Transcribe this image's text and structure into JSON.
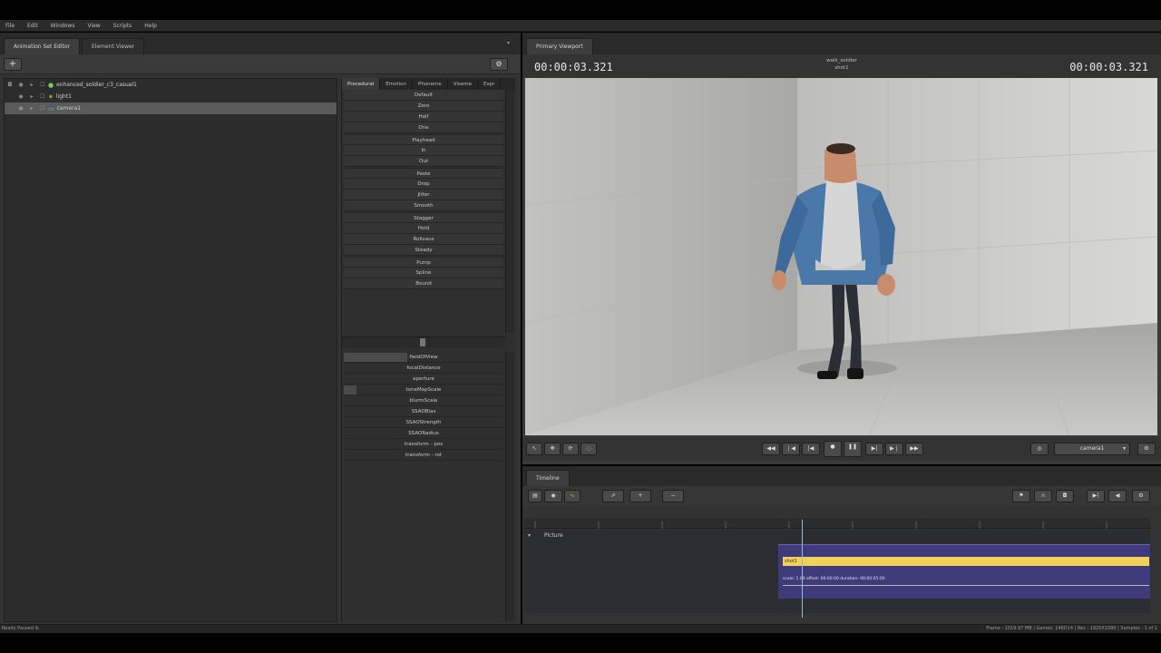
{
  "menu": [
    "File",
    "Edit",
    "Windows",
    "View",
    "Scripts",
    "Help"
  ],
  "left_tabs": [
    "Animation Set Editor",
    "Element Viewer"
  ],
  "tree_items": [
    {
      "label": "enhanced_soldier_c3_casual1",
      "selected": false
    },
    {
      "label": "light1",
      "selected": false
    },
    {
      "label": "camera1",
      "selected": true
    }
  ],
  "presets_tabs": [
    "Procedural",
    "Emotion",
    "Phoneme",
    "Viseme",
    "Expr"
  ],
  "preset_buttons": [
    {
      "label": "Default",
      "group": false
    },
    {
      "label": "Zero",
      "group": false
    },
    {
      "label": "Half",
      "group": false
    },
    {
      "label": "One",
      "group": false
    },
    {
      "label": "Playhead",
      "group": true
    },
    {
      "label": "In",
      "group": false
    },
    {
      "label": "Out",
      "group": false
    },
    {
      "label": "Paste",
      "group": true
    },
    {
      "label": "Drop",
      "group": false
    },
    {
      "label": "Jitter",
      "group": false
    },
    {
      "label": "Smooth",
      "group": false
    },
    {
      "label": "Stagger",
      "group": true
    },
    {
      "label": "Hold",
      "group": false
    },
    {
      "label": "Rollvaus",
      "group": false
    },
    {
      "label": "Steady",
      "group": false
    },
    {
      "label": "Pump",
      "group": true
    },
    {
      "label": "Spline",
      "group": false
    },
    {
      "label": "Bound",
      "group": false
    }
  ],
  "sliders": [
    {
      "label": "fieldOfView",
      "value": 0.4
    },
    {
      "label": "focalDistance",
      "value": 0.0
    },
    {
      "label": "aperture",
      "value": 0.0
    },
    {
      "label": "toneMapScale",
      "value": 0.08
    },
    {
      "label": "blurmScale",
      "value": 0.0
    },
    {
      "label": "SSAOBias",
      "value": 0.0
    },
    {
      "label": "SSAOStrength",
      "value": 0.0
    },
    {
      "label": "SSAORadius",
      "value": 0.0
    },
    {
      "label": "transform - pos",
      "value": 0.0
    },
    {
      "label": "transform - rot",
      "value": 0.0
    }
  ],
  "viewport": {
    "tab": "Primary Viewport",
    "timecode_left": "00:00:03.321",
    "timecode_right": "00:00:03.321",
    "title": "walk_soldier",
    "subtitle": "shot1",
    "camera_select": "camera1"
  },
  "timeline": {
    "tab": "Timeline",
    "track_label": "Picture",
    "clip_label": "shot1",
    "clip_info": "scale: 1.00 offset: 00:00:00 duration: 00:00:05:00"
  },
  "status": {
    "left": "Ready Paused lk",
    "right": "Frame : 1019.97 MB | Games: 146D14 | Res : 1920X1080 | Samples : 1 of 1"
  },
  "colors": {
    "panel": "#333333",
    "clip_bar": "#f1d15a",
    "clip_area": "#3f3a7a",
    "playhead": "#9fb6d6"
  }
}
